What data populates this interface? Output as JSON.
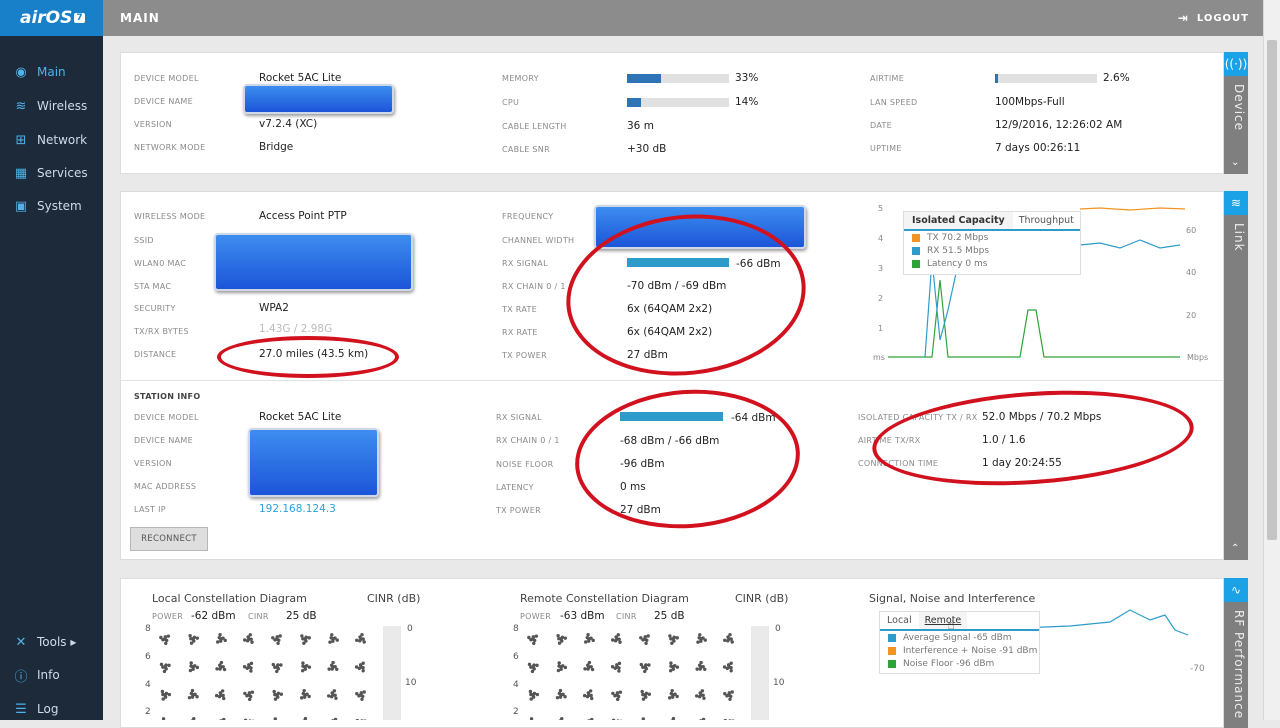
{
  "app": {
    "logo": "airOS",
    "logo_version": "7"
  },
  "header": {
    "title": "MAIN",
    "logout": "LOGOUT"
  },
  "nav": {
    "items": [
      {
        "label": "Main",
        "icon": "speedometer-icon"
      },
      {
        "label": "Wireless",
        "icon": "wifi-icon"
      },
      {
        "label": "Network",
        "icon": "network-icon"
      },
      {
        "label": "Services",
        "icon": "services-icon"
      },
      {
        "label": "System",
        "icon": "system-icon"
      }
    ],
    "bottom": [
      {
        "label": "Tools ▸",
        "icon": "tools-icon"
      },
      {
        "label": "Info",
        "icon": "info-icon"
      },
      {
        "label": "Log",
        "icon": "log-icon"
      }
    ]
  },
  "device": {
    "tab": "Device",
    "model_label": "DEVICE MODEL",
    "model": "Rocket 5AC Lite",
    "name_label": "DEVICE NAME",
    "version_label": "VERSION",
    "version": "v7.2.4 (XC)",
    "netmode_label": "NETWORK MODE",
    "netmode": "Bridge",
    "memory_label": "MEMORY",
    "memory": "33%",
    "memory_pct": 33,
    "cpu_label": "CPU",
    "cpu": "14%",
    "cpu_pct": 14,
    "cable_len_label": "CABLE LENGTH",
    "cable_len": "36 m",
    "cable_snr_label": "CABLE SNR",
    "cable_snr": "+30 dB",
    "airtime_label": "AIRTIME",
    "airtime": "2.6%",
    "airtime_pct": 2.6,
    "lan_label": "LAN SPEED",
    "lan": "100Mbps-Full",
    "date_label": "DATE",
    "date": "12/9/2016, 12:26:02 AM",
    "uptime_label": "UPTIME",
    "uptime": "7 days 00:26:11"
  },
  "link": {
    "tab": "Link",
    "wmode_label": "WIRELESS MODE",
    "wmode": "Access Point PTP",
    "ssid_label": "SSID",
    "wlan_mac_label": "WLAN0 MAC",
    "sta_mac_label": "STA MAC",
    "security_label": "SECURITY",
    "security": "WPA2",
    "bytes_label": "TX/RX BYTES",
    "bytes": "1.43G / 2.98G",
    "distance_label": "DISTANCE",
    "distance": "27.0 miles (43.5 km)",
    "freq_label": "FREQUENCY",
    "chwidth_label": "CHANNEL WIDTH",
    "rxsig_label": "RX SIGNAL",
    "rxsig": "-66 dBm",
    "rxsig_pct": 100,
    "rxchain_label": "RX CHAIN 0 / 1",
    "rxchain": "-70 dBm / -69 dBm",
    "txrate_label": "TX RATE",
    "txrate": "6x (64QAM 2x2)",
    "rxrate_label": "RX RATE",
    "rxrate": "6x (64QAM 2x2)",
    "txpower_label": "TX POWER",
    "txpower": "27 dBm",
    "chart": {
      "tabs": [
        "Isolated Capacity",
        "Throughput"
      ],
      "legend": [
        "TX 70.2 Mbps",
        "RX 51.5 Mbps",
        "Latency 0 ms"
      ],
      "colors": [
        "#f39323",
        "#2d9cca",
        "#2ea33a"
      ],
      "left_ticks": [
        "5",
        "4",
        "3",
        "2",
        "1",
        "ms"
      ],
      "right_ticks": [
        "60",
        "40",
        "20",
        "Mbps"
      ]
    },
    "station": {
      "title": "STATION INFO",
      "model_label": "DEVICE MODEL",
      "model": "Rocket 5AC Lite",
      "name_label": "DEVICE NAME",
      "version_label": "VERSION",
      "mac_label": "MAC ADDRESS",
      "lastip_label": "LAST IP",
      "lastip": "192.168.124.3",
      "rxsig_label": "RX SIGNAL",
      "rxsig": "-64 dBm",
      "rxsig_pct": 100,
      "rxchain_label": "RX CHAIN 0 / 1",
      "rxchain": "-68 dBm / -66 dBm",
      "noise_label": "NOISE FLOOR",
      "noise": "-96 dBm",
      "latency_label": "LATENCY",
      "latency": "0 ms",
      "txpower_label": "TX POWER",
      "txpower": "27 dBm",
      "capacity_label": "ISOLATED CAPACITY TX / RX",
      "capacity": "52.0 Mbps / 70.2 Mbps",
      "airtime_label": "AIRTIME TX/RX",
      "airtime": "1.0 / 1.6",
      "conn_label": "CONNECTION TIME",
      "conn": "1 day 20:24:55",
      "reconnect": "RECONNECT"
    }
  },
  "rf": {
    "tab": "RF Performance",
    "local_title": "Local Constellation Diagram",
    "local_power_label": "POWER",
    "local_power": "-62 dBm",
    "local_cinr_label": "CINR",
    "local_cinr": "25 dB",
    "remote_title": "Remote Constellation Diagram",
    "remote_power_label": "POWER",
    "remote_power": "-63 dBm",
    "remote_cinr_label": "CINR",
    "remote_cinr": "25 dB",
    "cinr_title": "CINR (dB)",
    "y_ticks": [
      "8",
      "6",
      "4",
      "2"
    ],
    "cinr_ticks": [
      "0",
      "10"
    ],
    "sni_title": "Signal, Noise and Interference",
    "sni_tabs": [
      "Local",
      "Remote"
    ],
    "sni_legend": [
      "Average Signal -65 dBm",
      "Interference + Noise -91 dBm",
      "Noise Floor -96 dBm"
    ],
    "sni_colors": [
      "#2d9cca",
      "#f39323",
      "#2ea33a"
    ],
    "sni_tick": "-70"
  }
}
